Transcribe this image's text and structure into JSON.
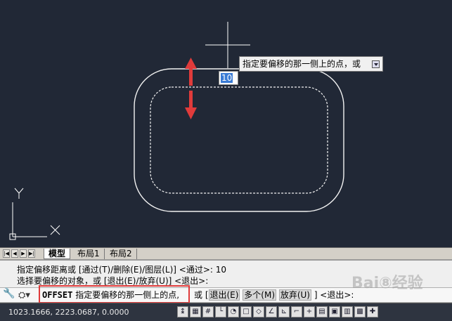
{
  "dynamic_input": {
    "tooltip": "指定要偏移的那一侧上的点，或",
    "value": "10"
  },
  "tabs": [
    {
      "label": "模型"
    },
    {
      "label": "布局1"
    },
    {
      "label": "布局2"
    }
  ],
  "history": [
    "指定偏移距离或 [通过(T)/删除(E)/图层(L)] <通过>: 10",
    "选择要偏移的对象，或 [退出(E)/放弃(U)] <退出>:"
  ],
  "command": {
    "name": "OFFSET",
    "prompt": "指定要偏移的那一侧上的点,",
    "or": "或 [",
    "option_exit": "退出(E)",
    "option_multiple": "多个(M)",
    "option_undo": "放弃(U)",
    "suffix": "] <退出>:"
  },
  "statusbar": {
    "coords": "1023.1666,  2223.0687, 0.0000"
  },
  "watermark": "Bai⑧经验",
  "colors": {
    "canvas": "#212836",
    "arrow": "#e03b3b",
    "highlight": "#e03b3b"
  }
}
